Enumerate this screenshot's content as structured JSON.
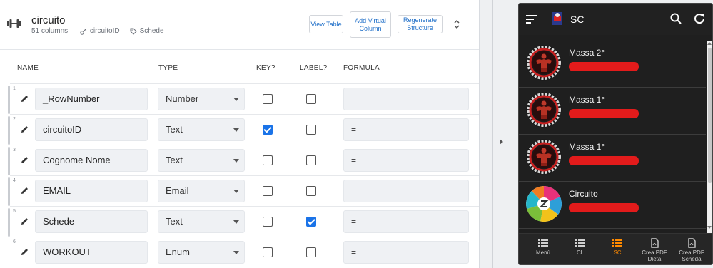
{
  "table": {
    "title": "circuito",
    "columns_count": "51 columns:",
    "key_column": "circuitoID",
    "label_column": "Schede"
  },
  "header_buttons": {
    "view_table": "View Table",
    "add_virtual_column": "Add Virtual Column",
    "regenerate_structure": "Regenerate Structure"
  },
  "column_headers": {
    "name": "NAME",
    "type": "TYPE",
    "key": "KEY?",
    "label": "LABEL?",
    "formula": "FORMULA"
  },
  "rows": [
    {
      "num": "1",
      "name": "_RowNumber",
      "type": "Number",
      "key": false,
      "label": false,
      "formula": "="
    },
    {
      "num": "2",
      "name": "circuitoID",
      "type": "Text",
      "key": true,
      "label": false,
      "formula": "="
    },
    {
      "num": "3",
      "name": "Cognome Nome",
      "type": "Text",
      "key": false,
      "label": false,
      "formula": "="
    },
    {
      "num": "4",
      "name": "EMAIL",
      "type": "Email",
      "key": false,
      "label": false,
      "formula": "="
    },
    {
      "num": "5",
      "name": "Schede",
      "type": "Text",
      "key": false,
      "label": true,
      "formula": "="
    },
    {
      "num": "6",
      "name": "WORKOUT",
      "type": "Enum",
      "key": false,
      "label": false,
      "formula": "="
    }
  ],
  "phone": {
    "title": "SC",
    "items": [
      {
        "title": "Massa 2°",
        "avatar": "bodybuilder-avatar"
      },
      {
        "title": "Massa 1°",
        "avatar": "bodybuilder-avatar"
      },
      {
        "title": "Massa 1°",
        "avatar": "bodybuilder-avatar"
      },
      {
        "title": "Circuito",
        "avatar": "circuit-logo-avatar"
      }
    ],
    "nav": [
      {
        "label": "Menù",
        "icon": "list-icon",
        "active": false
      },
      {
        "label": "CL",
        "icon": "list-icon",
        "active": false
      },
      {
        "label": "SC",
        "icon": "list-icon",
        "active": true
      },
      {
        "label": "Crea PDF Dieta",
        "icon": "pdf-icon",
        "active": false
      },
      {
        "label": "Crea PDF Scheda",
        "icon": "pdf-icon",
        "active": false
      }
    ]
  },
  "colors": {
    "accent_blue": "#1a73e8",
    "link_blue": "#1e6ec8",
    "active_nav": "#ff8a00",
    "redaction": "#e21b1b"
  }
}
